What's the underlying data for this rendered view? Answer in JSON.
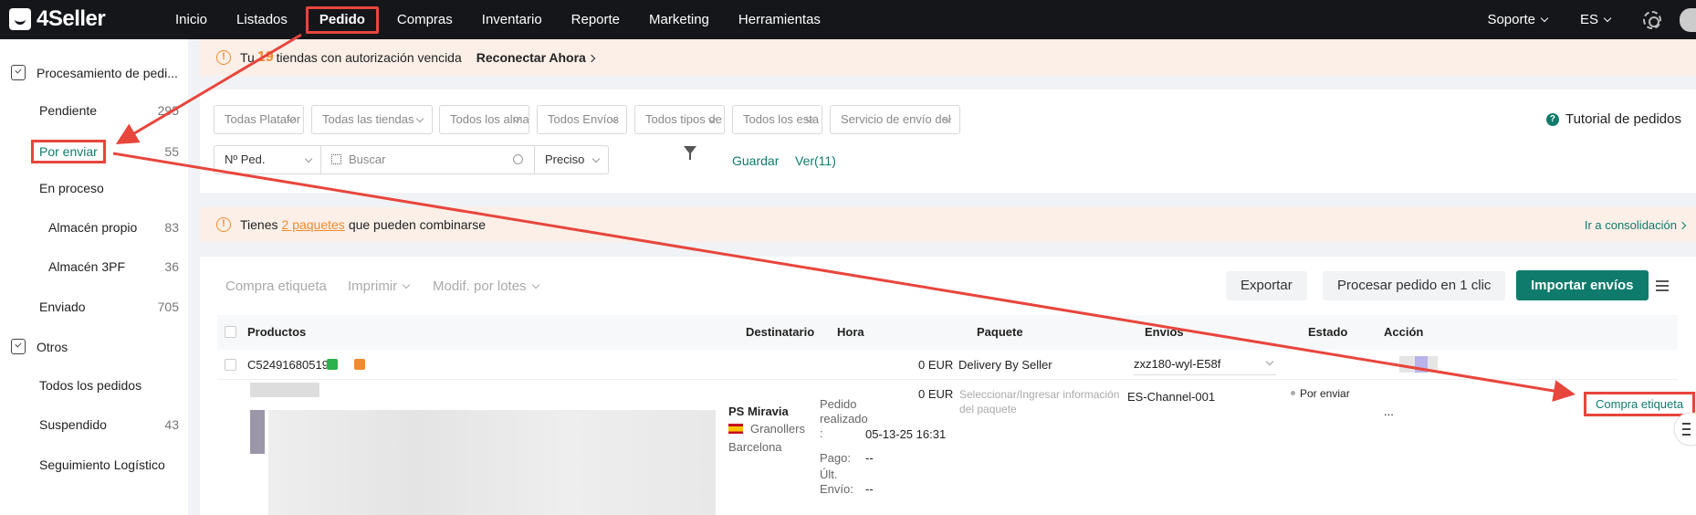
{
  "topbar": {
    "logo": "4Seller",
    "nav": [
      "Inicio",
      "Listados",
      "Pedido",
      "Compras",
      "Inventario",
      "Reporte",
      "Marketing",
      "Herramientas"
    ],
    "active_nav": "Pedido",
    "support": "Soporte",
    "language": "ES"
  },
  "sidebar": {
    "section1": "Procesamiento de pedi...",
    "items": [
      {
        "label": "Pendiente",
        "count": "295"
      },
      {
        "label": "Por enviar",
        "count": "55"
      },
      {
        "label": "En proceso",
        "count": ""
      },
      {
        "label": "Almacén propio",
        "count": "83"
      },
      {
        "label": "Almacén 3PF",
        "count": "36"
      },
      {
        "label": "Enviado",
        "count": "705"
      }
    ],
    "section2": "Otros",
    "items2": [
      {
        "label": "Todos los pedidos",
        "count": ""
      },
      {
        "label": "Suspendido",
        "count": "43"
      },
      {
        "label": "Seguimiento Logístico",
        "count": ""
      }
    ]
  },
  "warning1": {
    "prefix": "Tu",
    "number": "19",
    "text": "tiendas con autorización vencida",
    "action": "Reconectar Ahora"
  },
  "filters": {
    "dropdowns": [
      "Todas Platafor",
      "Todas las tiendas",
      "Todos los alma",
      "Todos Envíos",
      "Todos tipos de",
      "Todos los esta",
      "Servicio de envío del"
    ],
    "search_field": "Nº Ped.",
    "search_placeholder": "Buscar",
    "match_mode": "Preciso",
    "save": "Guardar",
    "view": "Ver(11)",
    "tutorial": "Tutorial de pedidos"
  },
  "warning2": {
    "prefix": "Tienes",
    "link": "2 paquetes",
    "text": "que pueden combinarse",
    "action": "Ir a consolidación"
  },
  "toolbar": {
    "compra": "Compra etiqueta",
    "imprimir": "Imprimir",
    "modif": "Modif. por lotes",
    "exportar": "Exportar",
    "procesar": "Procesar pedido en 1 clic",
    "importar": "Importar envíos"
  },
  "table": {
    "headers": [
      "Productos",
      "Destinatario",
      "Hora",
      "Paquete",
      "Envíos",
      "Estado",
      "Acción"
    ],
    "order_id": "C52491680519",
    "price1": "0 EUR",
    "price2": "0 EUR",
    "paquete": "Delivery By Seller",
    "envio_code": "zxz180-wyl-E58f",
    "paquete_info": "Seleccionar/Ingresar información del paquete",
    "channel": "ES-Channel-001",
    "estado": "Por enviar",
    "accion": "Compra etiqueta",
    "more": "...",
    "recipient_name": "PS Miravia",
    "recipient_city": "Granollers",
    "recipient_region": "Barcelona",
    "time_label1": "Pedido realizado :",
    "time_value1": "05-13-25 16:31",
    "time_label2": "Pago:",
    "time_value2": "--",
    "time_label3": "Últ. Envío:",
    "time_value3": "--"
  },
  "colors": {
    "brand": "#0f7b6c",
    "highlight": "#e8453c",
    "warning": "#f08b2d",
    "topbar": "#14161a"
  }
}
